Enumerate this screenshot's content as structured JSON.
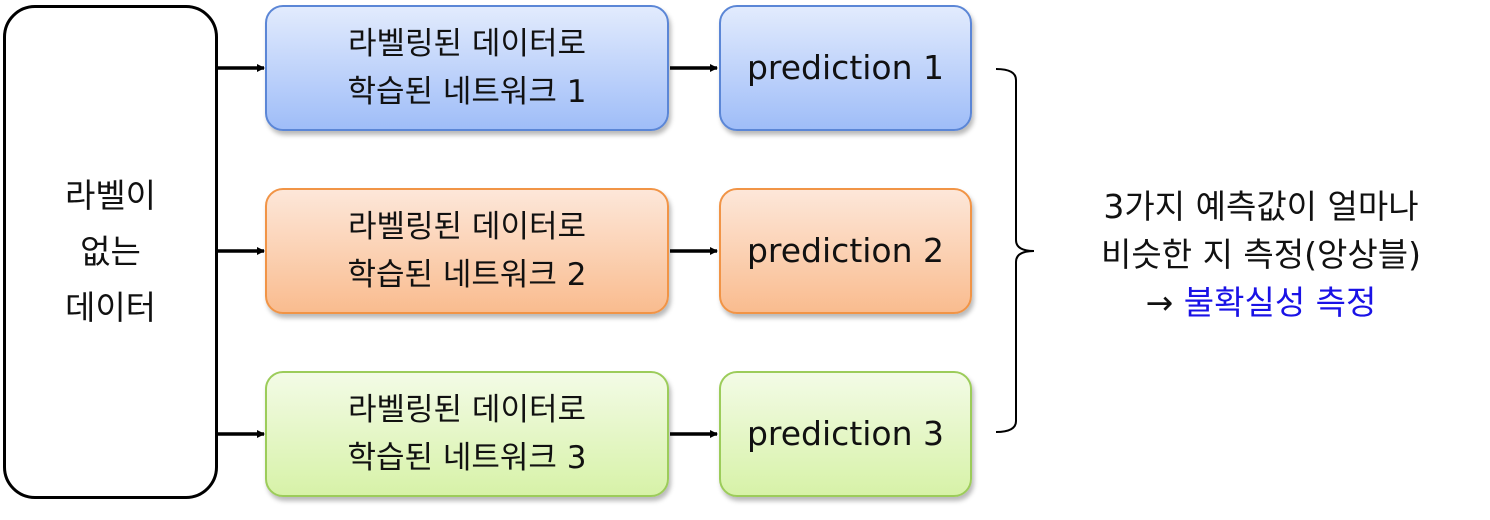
{
  "source": {
    "lines": [
      "라벨이",
      "없는",
      "데이터"
    ]
  },
  "networks": [
    {
      "line1": "라벨링된 데이터로",
      "line2": "학습된 네트워크 1",
      "prediction": "prediction 1"
    },
    {
      "line1": "라벨링된 데이터로",
      "line2": "학습된 네트워크 2",
      "prediction": "prediction 2"
    },
    {
      "line1": "라벨링된 데이터로",
      "line2": "학습된 네트워크 3",
      "prediction": "prediction 3"
    }
  ],
  "result": {
    "line1": "3가지 예측값이 얼마나",
    "line2": "비슷한 지 측정(앙상블)",
    "arrow": "→",
    "conclusion": "불확실성 측정"
  },
  "colors": {
    "network1": "#9fbdf8",
    "network2": "#f9bc8f",
    "network3": "#d7f2a8",
    "accent_text": "#1a12e6",
    "border": "#000000"
  }
}
